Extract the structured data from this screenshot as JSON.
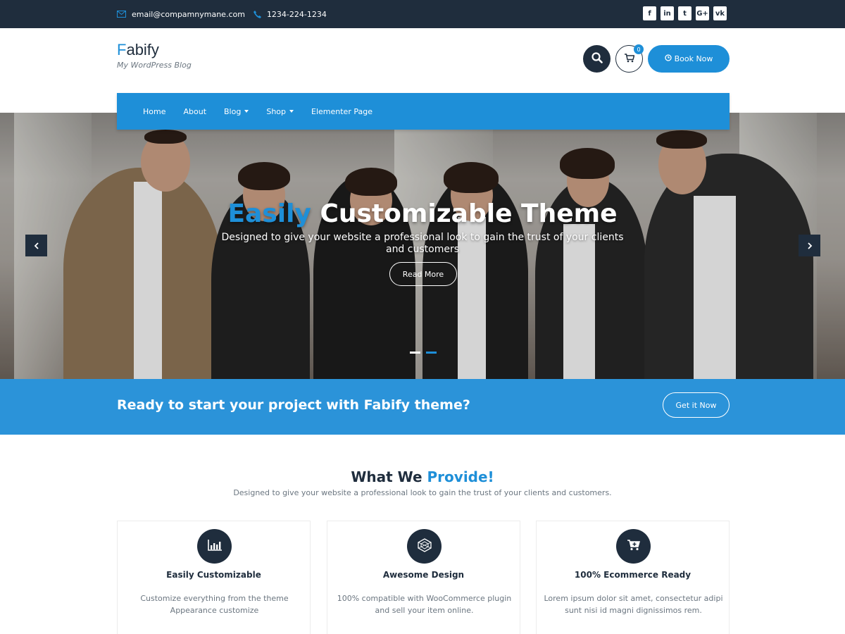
{
  "topbar": {
    "email": "email@compamnymane.com",
    "phone": "1234-224-1234",
    "social": [
      {
        "icon": "facebook-icon",
        "glyph": "f"
      },
      {
        "icon": "linkedin-icon",
        "glyph": "in"
      },
      {
        "icon": "twitter-icon",
        "glyph": "t"
      },
      {
        "icon": "google-plus-icon",
        "glyph": "G+"
      },
      {
        "icon": "vk-icon",
        "glyph": "vk"
      }
    ]
  },
  "header": {
    "logo_first": "F",
    "logo_rest": "abify",
    "tagline": "My WordPress Blog",
    "cart_count": "0",
    "book_label": "Book Now"
  },
  "nav": {
    "items": [
      {
        "label": "Home",
        "dropdown": false
      },
      {
        "label": "About",
        "dropdown": false
      },
      {
        "label": "Blog",
        "dropdown": true
      },
      {
        "label": "Shop",
        "dropdown": true
      },
      {
        "label": "Elementer Page",
        "dropdown": false
      }
    ]
  },
  "hero": {
    "title_highlight": "Easily",
    "title_rest": " Customizable Theme",
    "subtitle": "Designed to give your website a professional look to gain the trust of your clients and customers",
    "button": "Read More"
  },
  "cta": {
    "text": "Ready to start your project with Fabify theme?",
    "button": "Get it Now"
  },
  "provide": {
    "title_main": "What We ",
    "title_highlight": "Provide!",
    "subtitle": "Designed to give your website a professional look to gain the trust of your clients and customers.",
    "cards": [
      {
        "icon": "bar-chart-icon",
        "title": "Easily Customizable",
        "text": "Customize everything from the theme Appearance customize"
      },
      {
        "icon": "design-pattern-icon",
        "title": "Awesome Design",
        "text": "100% compatible with WooCommerce plugin and sell your item online."
      },
      {
        "icon": "cart-plus-icon",
        "title": "100% Ecommerce Ready",
        "text": "Lorem ipsum dolor sit amet, consectetur adipi sunt nisi id magni dignissimos rem."
      }
    ]
  },
  "colors": {
    "accent": "#1e8fd8",
    "dark": "#1f2d3d",
    "cta_band": "#2b93d9"
  }
}
